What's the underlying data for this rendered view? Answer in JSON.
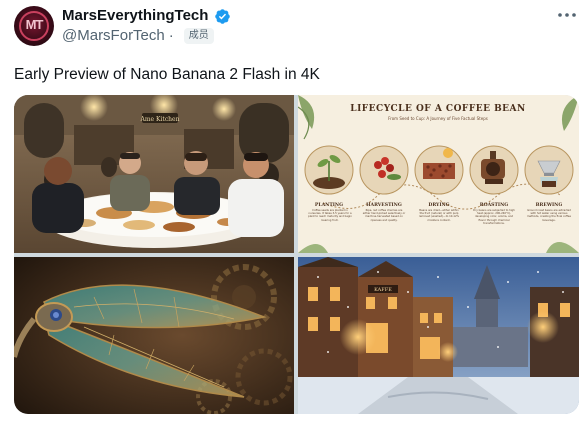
{
  "author": {
    "display_name": "MarsEverythingTech",
    "handle": "@MarsForTech",
    "separator": "·",
    "badge": "成员",
    "avatar_initials": "MT"
  },
  "tweet": {
    "text": "Early Preview of Nano Banana 2 Flash in 4K"
  },
  "infographic": {
    "title": "LIFECYCLE OF A COFFEE BEAN",
    "subtitle": "From Seed to Cup: A Journey of Five Factual Steps",
    "stages": [
      {
        "name": "PLANTING",
        "caption": "Coffee seeds are planted in nurseries. It takes 3-5 years for a plant to reach maturity and begin bearing fruit."
      },
      {
        "name": "HARVESTING",
        "caption": "Ripe, red coffee cherries are either hand-picked selectively or machine-harvested based on ripeness and quality."
      },
      {
        "name": "DRYING",
        "caption": "Beans are dried—either within the fruit (natural) or with pulp removed (washed)—to 10-12% moisture content."
      },
      {
        "name": "ROASTING",
        "caption": "Dry beans are subjected to high heat (approx. 200-240°C), developing color, aroma, and flavor through chemical transformations."
      },
      {
        "name": "BREWING",
        "caption": "Ground roast beans are extracted with hot water using various methods, creating the final coffee beverage."
      }
    ]
  },
  "restaurant_sign": "Ame Kitchen",
  "street_sign": "KAFFE",
  "colors": {
    "verified_blue": "#1d9bf0",
    "text_primary": "#0f1419",
    "text_secondary": "#536471"
  },
  "icons": [
    "verified-badge-icon",
    "more-options-icon"
  ]
}
